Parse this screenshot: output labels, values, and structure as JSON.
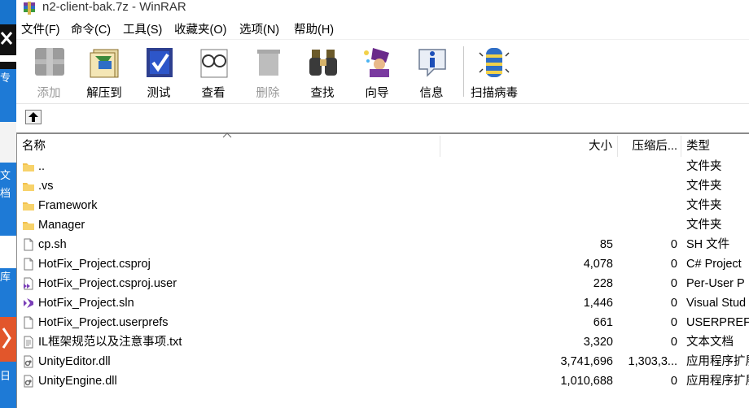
{
  "window": {
    "title": "n2-client-bak.7z - WinRAR"
  },
  "menu": [
    "文件(F)",
    "命令(C)",
    "工具(S)",
    "收藏夹(O)",
    "选项(N)",
    "帮助(H)"
  ],
  "toolbar": {
    "add": "添加",
    "extract": "解压到",
    "test": "测试",
    "view": "查看",
    "delete": "删除",
    "find": "查找",
    "wizard": "向导",
    "info": "信息",
    "virus": "扫描病毒"
  },
  "columns": {
    "name": "名称",
    "size": "大小",
    "packed": "压缩后...",
    "type": "类型"
  },
  "files": [
    {
      "name": "..",
      "size": "",
      "packed": "",
      "type": "文件夹",
      "icon": "folder-icon"
    },
    {
      "name": ".vs",
      "size": "",
      "packed": "",
      "type": "文件夹",
      "icon": "folder-icon"
    },
    {
      "name": "Framework",
      "size": "",
      "packed": "",
      "type": "文件夹",
      "icon": "folder-icon"
    },
    {
      "name": "Manager",
      "size": "",
      "packed": "",
      "type": "文件夹",
      "icon": "folder-icon"
    },
    {
      "name": "cp.sh",
      "size": "85",
      "packed": "0",
      "type": "SH 文件",
      "icon": "file-icon"
    },
    {
      "name": "HotFix_Project.csproj",
      "size": "4,078",
      "packed": "0",
      "type": "C# Project",
      "icon": "file-icon"
    },
    {
      "name": "HotFix_Project.csproj.user",
      "size": "228",
      "packed": "0",
      "type": "Per-User P",
      "icon": "vs-user-file-icon"
    },
    {
      "name": "HotFix_Project.sln",
      "size": "1,446",
      "packed": "0",
      "type": "Visual Stud",
      "icon": "vs-solution-icon"
    },
    {
      "name": "HotFix_Project.userprefs",
      "size": "661",
      "packed": "0",
      "type": "USERPREFS",
      "icon": "file-icon"
    },
    {
      "name": "IL框架规范以及注意事项.txt",
      "size": "3,320",
      "packed": "0",
      "type": "文本文档",
      "icon": "text-file-icon"
    },
    {
      "name": "UnityEditor.dll",
      "size": "3,741,696",
      "packed": "1,303,3...",
      "type": "应用程序扩展",
      "icon": "dll-icon"
    },
    {
      "name": "UnityEngine.dll",
      "size": "1,010,688",
      "packed": "0",
      "type": "应用程序扩展",
      "icon": "dll-icon"
    }
  ],
  "desktop": {
    "labels": [
      "专",
      "文档",
      "库",
      "日"
    ]
  }
}
